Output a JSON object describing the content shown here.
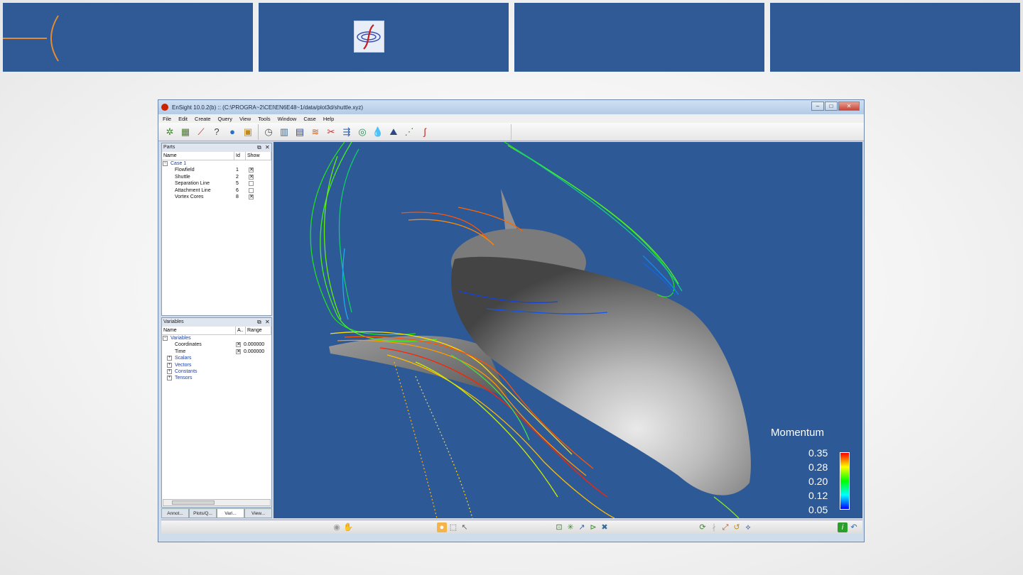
{
  "app": {
    "title": "EnSight 10.0.2(b) ::  (C:\\PROGRA~2\\CEI\\EN6E48~1/data/plot3d/shuttle.xyz)",
    "menu": [
      "File",
      "Edit",
      "Create",
      "Query",
      "View",
      "Tools",
      "Window",
      "Case",
      "Help"
    ]
  },
  "toolbar_icons": [
    "parts-icon",
    "calculator-icon",
    "plot-icon",
    "query-icon",
    "globe-icon",
    "toolbox-icon",
    "clock-icon",
    "book-icon",
    "clapper-icon",
    "streamline-icon",
    "scissors-icon",
    "vector-arrows-icon",
    "isosurface-icon",
    "drops-icon",
    "elevation-icon",
    "particle-trace-icon",
    "ensight-logo-icon"
  ],
  "parts_panel": {
    "title": "Parts",
    "columns": [
      "Name",
      "Id",
      "Show"
    ],
    "case_label": "Case 1",
    "rows": [
      {
        "name": "Flowfield",
        "id": "1",
        "show": true
      },
      {
        "name": "Shuttle",
        "id": "2",
        "show": true
      },
      {
        "name": "Separation Line",
        "id": "5",
        "show": false
      },
      {
        "name": "Attachment Line",
        "id": "6",
        "show": false
      },
      {
        "name": "Vortex Cores",
        "id": "8",
        "show": true
      }
    ]
  },
  "variables_panel": {
    "title": "Variables",
    "columns": [
      "Name",
      "A..",
      "Range"
    ],
    "root_label": "Variables",
    "rows": [
      {
        "name": "Coordinates",
        "value": "0.000000"
      },
      {
        "name": "Time",
        "value": "0.000000"
      }
    ],
    "groups": [
      "Scalars",
      "Vectors",
      "Constants",
      "Tensors"
    ]
  },
  "bottom_tabs": [
    "Annot...",
    "Plots/Q...",
    "Vari...",
    "View..."
  ],
  "active_tab": 2,
  "legend": {
    "title": "Momentum",
    "ticks": [
      "0.35",
      "0.28",
      "0.20",
      "0.12",
      "0.05"
    ]
  }
}
